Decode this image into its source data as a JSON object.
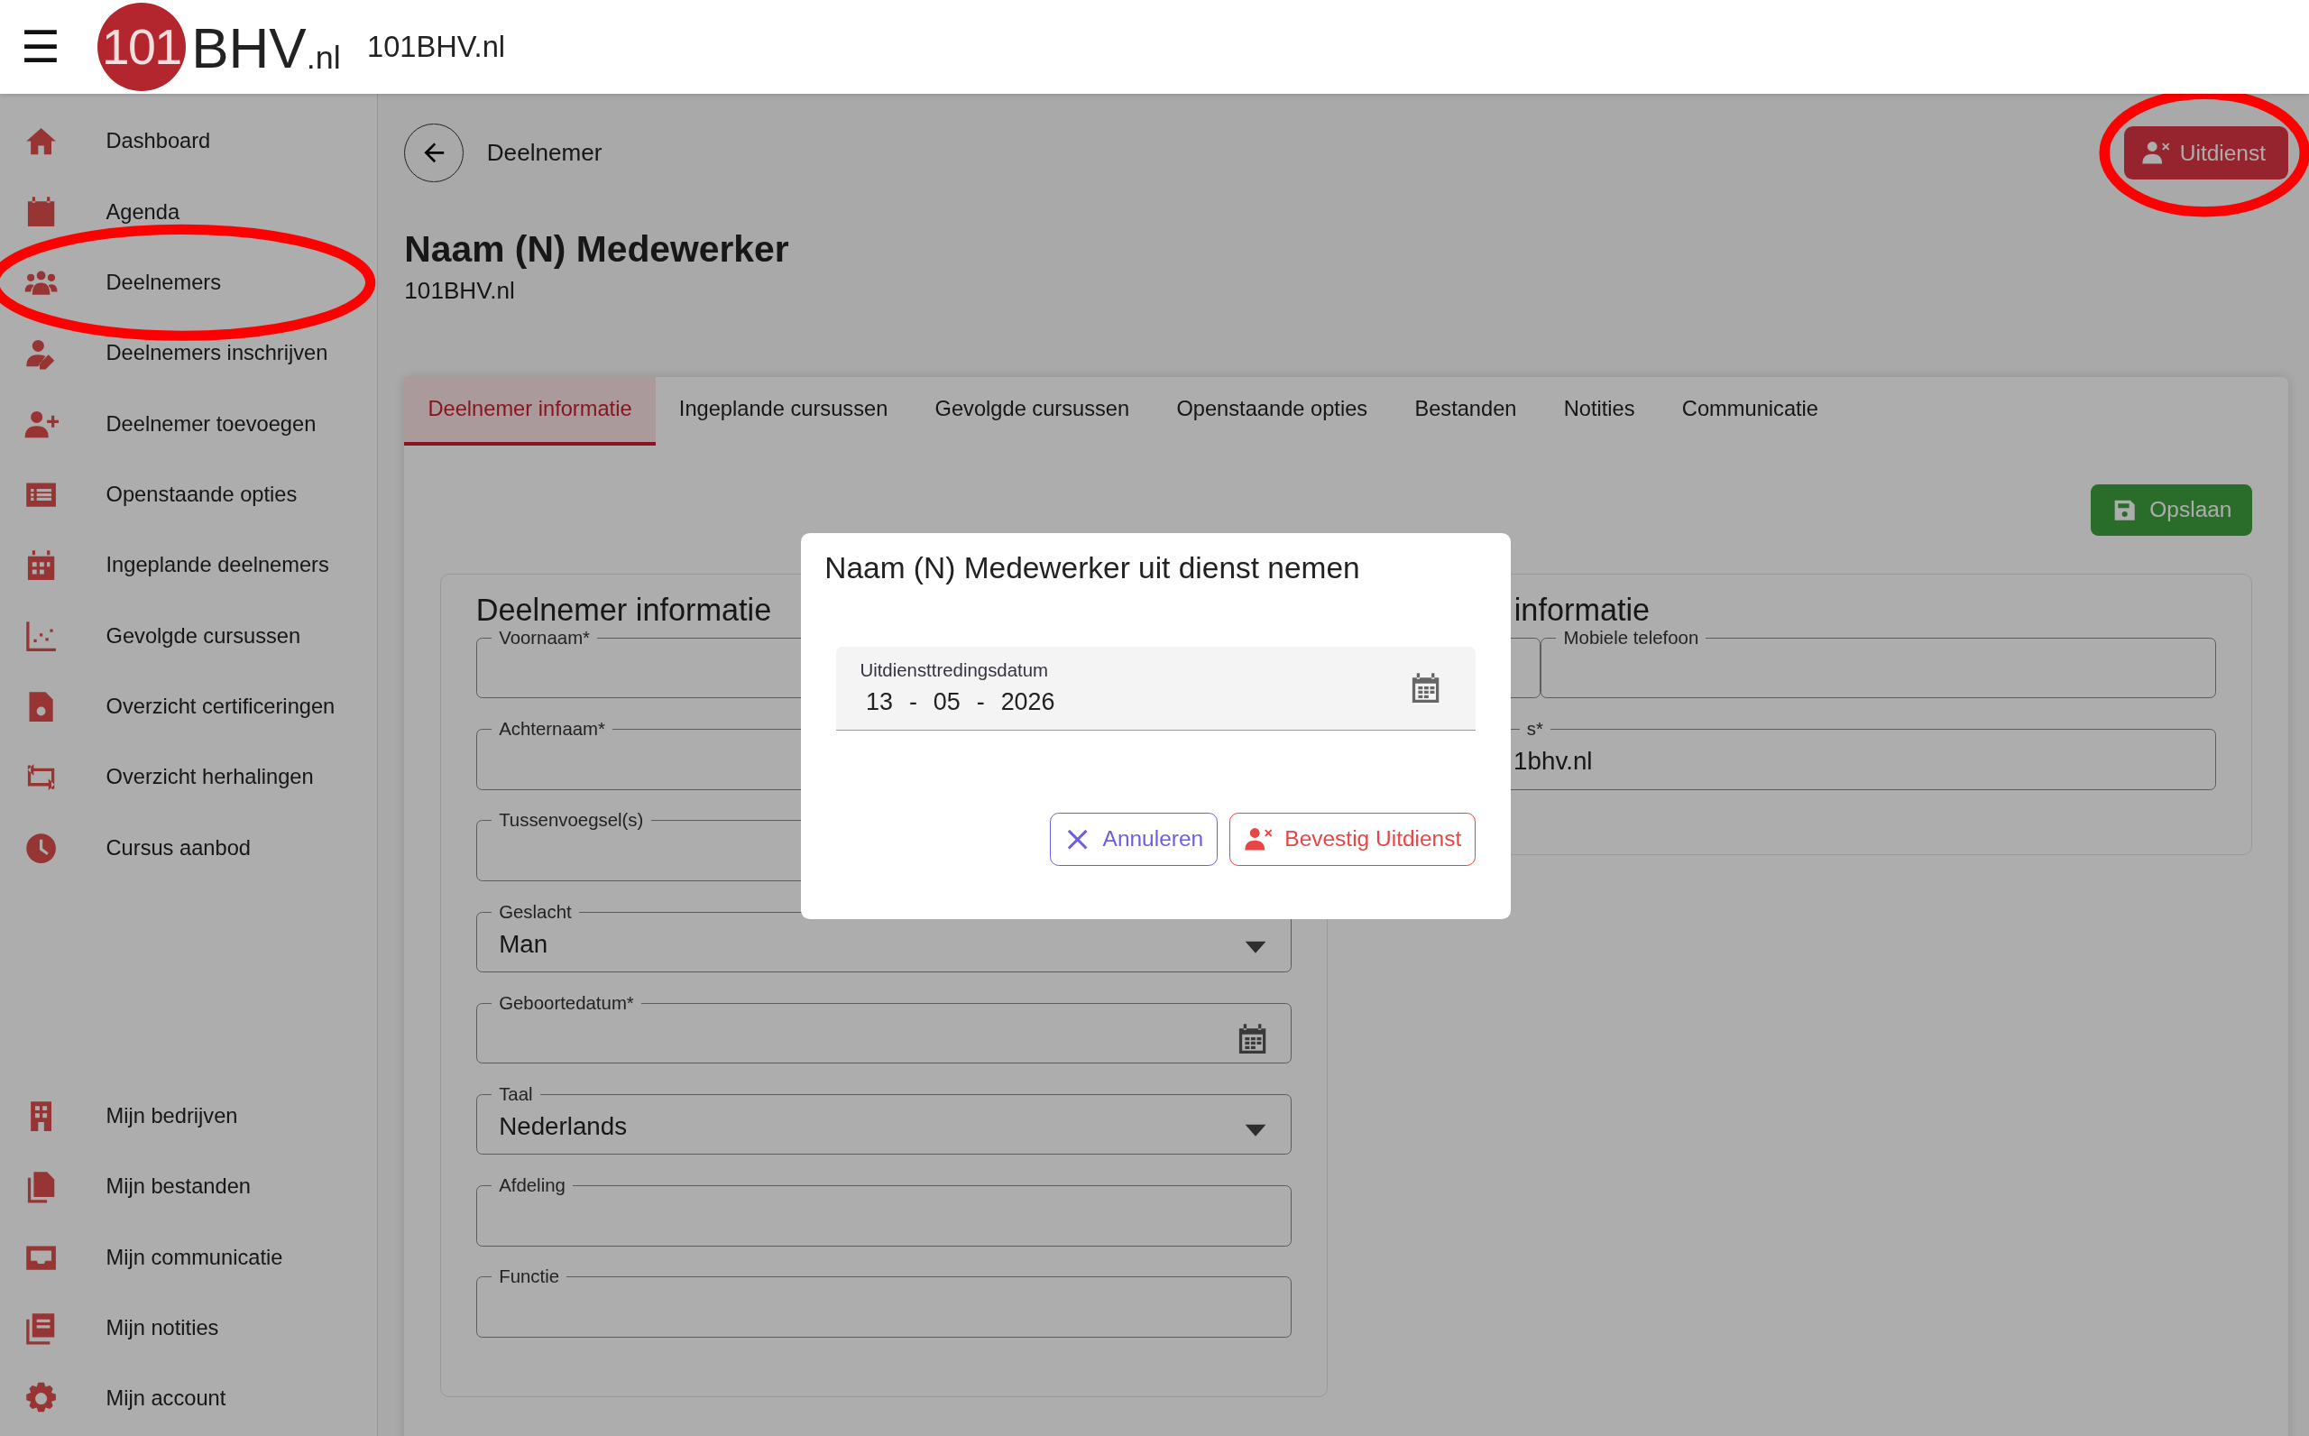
{
  "header": {
    "menu_icon": "☰",
    "logo": {
      "badge": "101",
      "name": "BHV",
      "suffix": ".nl"
    },
    "title": "101BHV.nl"
  },
  "sidebar": {
    "items": [
      {
        "label": "Dashboard"
      },
      {
        "label": "Agenda"
      },
      {
        "label": "Deelnemers"
      },
      {
        "label": "Deelnemers inschrijven"
      },
      {
        "label": "Deelnemer toevoegen"
      },
      {
        "label": "Openstaande opties"
      },
      {
        "label": "Ingeplande deelnemers"
      },
      {
        "label": "Gevolgde cursussen"
      },
      {
        "label": "Overzicht certificeringen"
      },
      {
        "label": "Overzicht herhalingen"
      },
      {
        "label": "Cursus aanbod"
      }
    ],
    "bottom_items": [
      {
        "label": "Mijn bedrijven"
      },
      {
        "label": "Mijn bestanden"
      },
      {
        "label": "Mijn communicatie"
      },
      {
        "label": "Mijn notities"
      },
      {
        "label": "Mijn account"
      }
    ]
  },
  "page": {
    "back_label": "Deelnemer",
    "action_button": "Uitdienst",
    "title": "Naam (N) Medewerker",
    "subtitle": "101BHV.nl"
  },
  "tabs": [
    {
      "label": "Deelnemer informatie",
      "selected": true
    },
    {
      "label": "Ingeplande cursussen",
      "selected": false
    },
    {
      "label": "Gevolgde cursussen",
      "selected": false
    },
    {
      "label": "Openstaande opties",
      "selected": false
    },
    {
      "label": "Bestanden",
      "selected": false
    },
    {
      "label": "Notities",
      "selected": false
    },
    {
      "label": "Communicatie",
      "selected": false
    }
  ],
  "save_button": "Opslaan",
  "left_section": {
    "title": "Deelnemer informatie",
    "fields": [
      {
        "kind": "text",
        "label": "Voornaam*"
      },
      {
        "kind": "text",
        "label": "Achternaam*"
      },
      {
        "kind": "text",
        "label": "Tussenvoegsel(s)"
      },
      {
        "kind": "select",
        "label": "Geslacht",
        "value": "Man"
      },
      {
        "kind": "date",
        "label": "Geboortedatum*"
      },
      {
        "kind": "select",
        "label": "Taal",
        "value": "Nederlands"
      },
      {
        "kind": "text",
        "label": "Afdeling"
      },
      {
        "kind": "text",
        "label": "Functie"
      }
    ]
  },
  "right_section": {
    "title": "informatie",
    "phone_label": "Mobiele telefoon",
    "email_label": "s*",
    "email_value": "1bhv.nl"
  },
  "dialog": {
    "title": "Naam (N) Medewerker uit dienst nemen",
    "date_field": {
      "label": "Uitdiensttredingsdatum",
      "day": "13",
      "month": "05",
      "year": "2026",
      "separator": "-"
    },
    "cancel_button": "Annuleren",
    "confirm_button": "Bevestig Uitdienst"
  }
}
